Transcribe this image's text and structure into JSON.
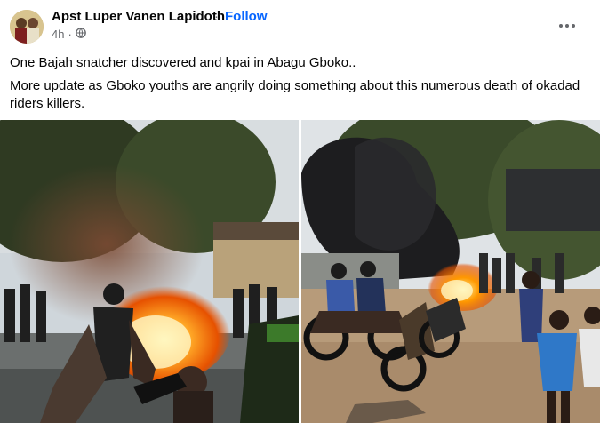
{
  "post": {
    "author": "Apst Luper Vanen Lapidoth",
    "separator": "·",
    "follow_label": "Follow",
    "timestamp": "4h",
    "audience_icon": "globe-icon",
    "more_icon": "more-options-icon",
    "text_lines": [
      "One Bajah snatcher discovered and kpai in Abagu Gboko..",
      "More update as Gboko youths are angrily doing something about this numerous death of okadad riders killers."
    ]
  },
  "photos": [
    {
      "description_icon": "photo-fire-street-left"
    },
    {
      "description_icon": "photo-fire-street-right"
    }
  ]
}
